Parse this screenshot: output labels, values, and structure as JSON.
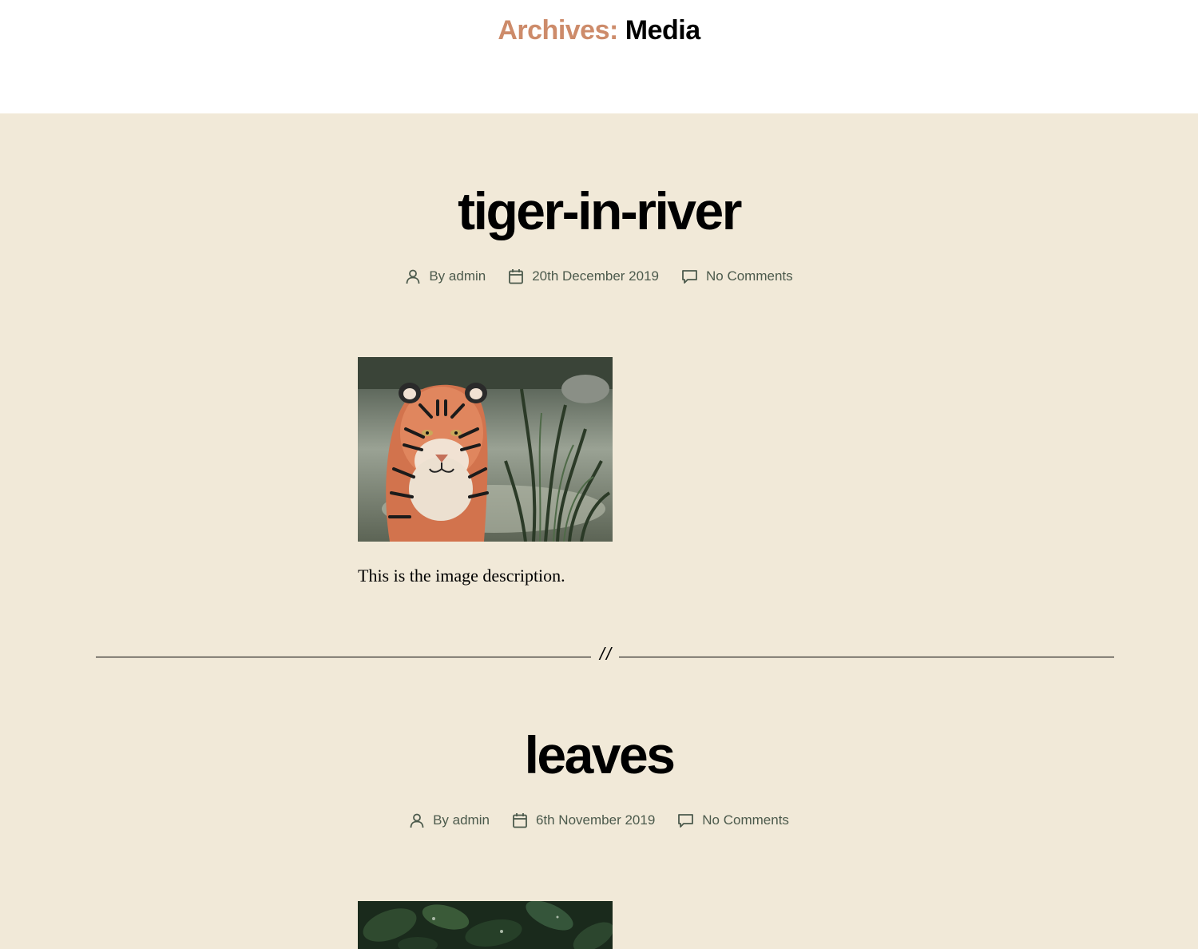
{
  "archive": {
    "prefix": "Archives:",
    "term": "Media"
  },
  "posts": [
    {
      "title": "tiger-in-river",
      "author": "By admin",
      "date": "20th December 2019",
      "comments": "No Comments",
      "description": "This is the image description."
    },
    {
      "title": "leaves",
      "author": "By admin",
      "date": "6th November 2019",
      "comments": "No Comments"
    }
  ],
  "separator": {
    "mark": "//"
  },
  "colors": {
    "background": "#f1e9d8",
    "accent": "#cd8b6a",
    "meta_text": "#4c5a4c"
  },
  "icons": {
    "author": "person-icon",
    "date": "calendar-icon",
    "comments": "comment-bubble-icon"
  }
}
